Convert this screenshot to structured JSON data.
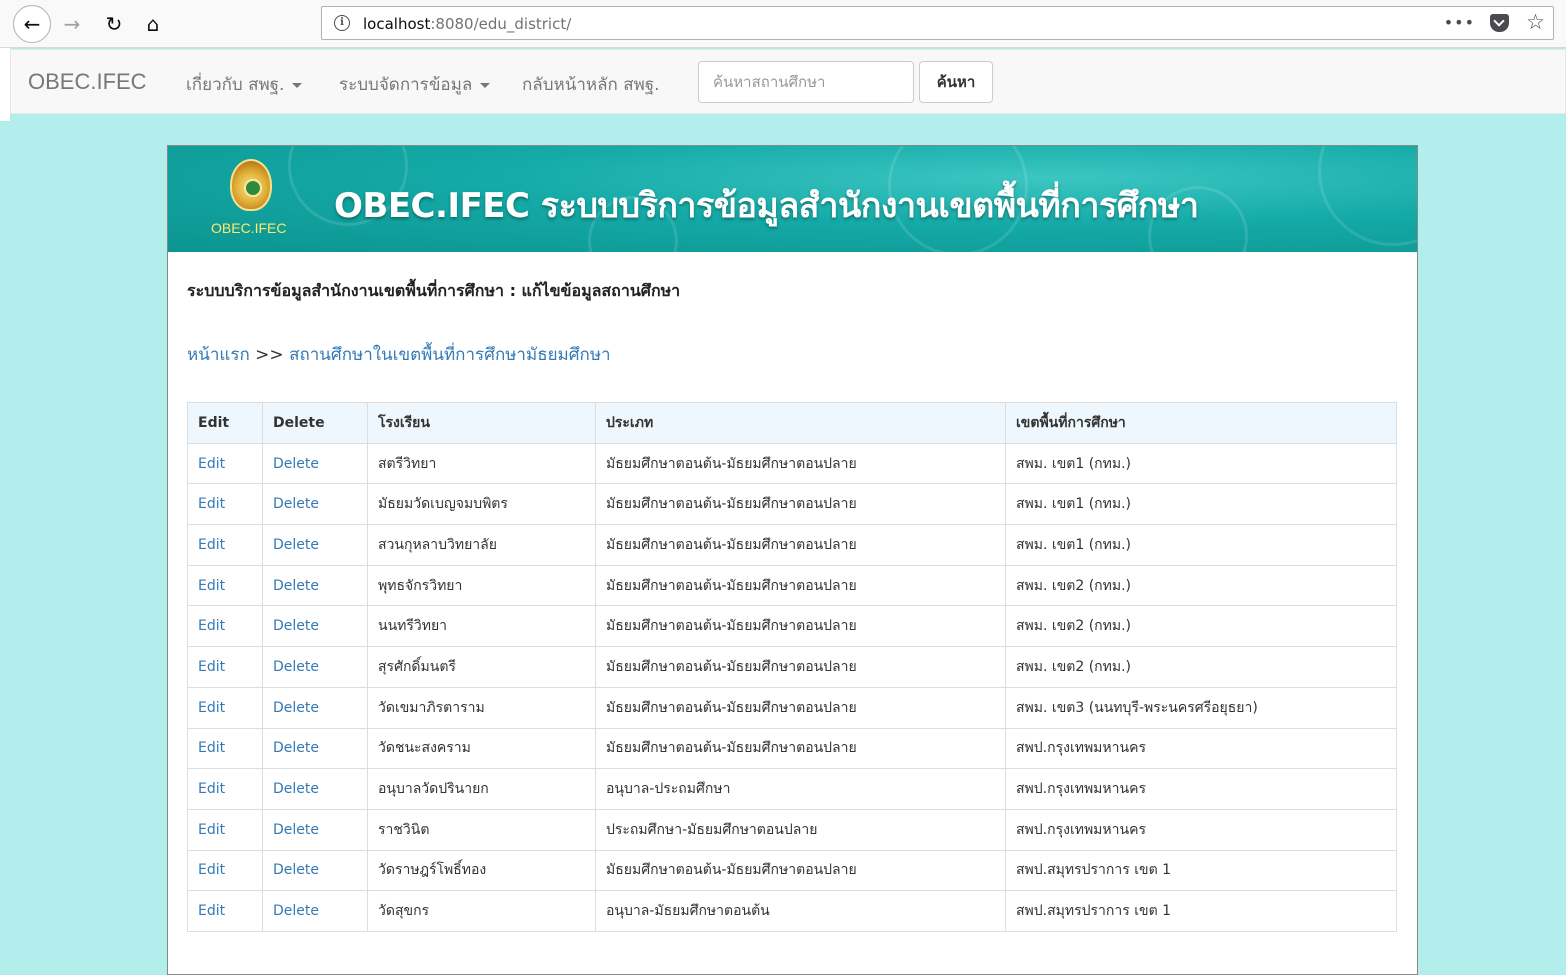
{
  "browser": {
    "url_host": "localhost",
    "url_path": ":8080/edu_district/"
  },
  "navbar": {
    "brand": "OBEC.IFEC",
    "menu_about": "เกี่ยวกับ สพฐ.",
    "menu_data": "ระบบจัดการข้อมูล",
    "menu_home": "กลับหน้าหลัก สพฐ.",
    "search_placeholder": "ค้นหาสถานศึกษา",
    "search_button": "ค้นหา"
  },
  "banner": {
    "logo_label": "OBEC.IFEC",
    "title": "OBEC.IFEC ระบบบริการข้อมูลสำนักงานเขตพื้นที่การศึกษา"
  },
  "page": {
    "heading": "ระบบบริการข้อมูลสำนักงานเขตพื้นที่การศึกษา : แก้ไขข้อมูลสถานศึกษา",
    "breadcrumb_home": "หน้าแรก",
    "breadcrumb_sep": ">>",
    "breadcrumb_current": "สถานศึกษาในเขตพื้นที่การศึกษามัธยมศึกษา"
  },
  "table": {
    "headers": [
      "Edit",
      "Delete",
      "โรงเรียน",
      "ประเภท",
      "เขตพื้นที่การศึกษา"
    ],
    "rows": [
      {
        "edit": "Edit",
        "delete": "Delete",
        "school": "สตรีวิทยา",
        "type": "มัธยมศึกษาตอนต้น-มัธยมศึกษาตอนปลาย",
        "district": "สพม. เขต1 (กทม.)"
      },
      {
        "edit": "Edit",
        "delete": "Delete",
        "school": "มัธยมวัดเบญจมบพิตร",
        "type": "มัธยมศึกษาตอนต้น-มัธยมศึกษาตอนปลาย",
        "district": "สพม. เขต1 (กทม.)"
      },
      {
        "edit": "Edit",
        "delete": "Delete",
        "school": "สวนกุหลาบวิทยาลัย",
        "type": "มัธยมศึกษาตอนต้น-มัธยมศึกษาตอนปลาย",
        "district": "สพม. เขต1 (กทม.)"
      },
      {
        "edit": "Edit",
        "delete": "Delete",
        "school": "พุทธจักรวิทยา",
        "type": "มัธยมศึกษาตอนต้น-มัธยมศึกษาตอนปลาย",
        "district": "สพม. เขต2 (กทม.)"
      },
      {
        "edit": "Edit",
        "delete": "Delete",
        "school": "นนทรีวิทยา",
        "type": "มัธยมศึกษาตอนต้น-มัธยมศึกษาตอนปลาย",
        "district": "สพม. เขต2 (กทม.)"
      },
      {
        "edit": "Edit",
        "delete": "Delete",
        "school": "สุรศักดิ์มนตรี",
        "type": "มัธยมศึกษาตอนต้น-มัธยมศึกษาตอนปลาย",
        "district": "สพม. เขต2 (กทม.)"
      },
      {
        "edit": "Edit",
        "delete": "Delete",
        "school": "วัดเขมาภิรตาราม",
        "type": "มัธยมศึกษาตอนต้น-มัธยมศึกษาตอนปลาย",
        "district": "สพม. เขต3 (นนทบุรี-พระนครศรีอยุธยา)"
      },
      {
        "edit": "Edit",
        "delete": "Delete",
        "school": "วัดชนะสงคราม",
        "type": "มัธยมศึกษาตอนต้น-มัธยมศึกษาตอนปลาย",
        "district": "สพป.กรุงเทพมหานคร"
      },
      {
        "edit": "Edit",
        "delete": "Delete",
        "school": "อนุบาลวัดปรินายก",
        "type": "อนุบาล-ประถมศึกษา",
        "district": "สพป.กรุงเทพมหานคร"
      },
      {
        "edit": "Edit",
        "delete": "Delete",
        "school": "ราชวินิต",
        "type": "ประถมศึกษา-มัธยมศึกษาตอนปลาย",
        "district": "สพป.กรุงเทพมหานคร"
      },
      {
        "edit": "Edit",
        "delete": "Delete",
        "school": "วัดราษฎร์โพธิ์ทอง",
        "type": "มัธยมศึกษาตอนต้น-มัธยมศึกษาตอนปลาย",
        "district": "สพป.สมุทรปราการ เขต 1"
      },
      {
        "edit": "Edit",
        "delete": "Delete",
        "school": "วัดสุขกร",
        "type": "อนุบาล-มัธยมศึกษาตอนต้น",
        "district": "สพป.สมุทรปราการ เขต 1"
      }
    ]
  },
  "icons": {
    "back": "back-arrow-icon",
    "forward": "forward-arrow-icon",
    "reload": "reload-icon",
    "home": "home-icon",
    "info": "info-icon",
    "more": "more-dots-icon",
    "pocket": "pocket-icon",
    "bookmark": "star-icon"
  },
  "colors": {
    "page_background": "#b1eeec",
    "link": "#337ab7",
    "banner": "#14aaa7",
    "table_header": "#eef7fd"
  }
}
